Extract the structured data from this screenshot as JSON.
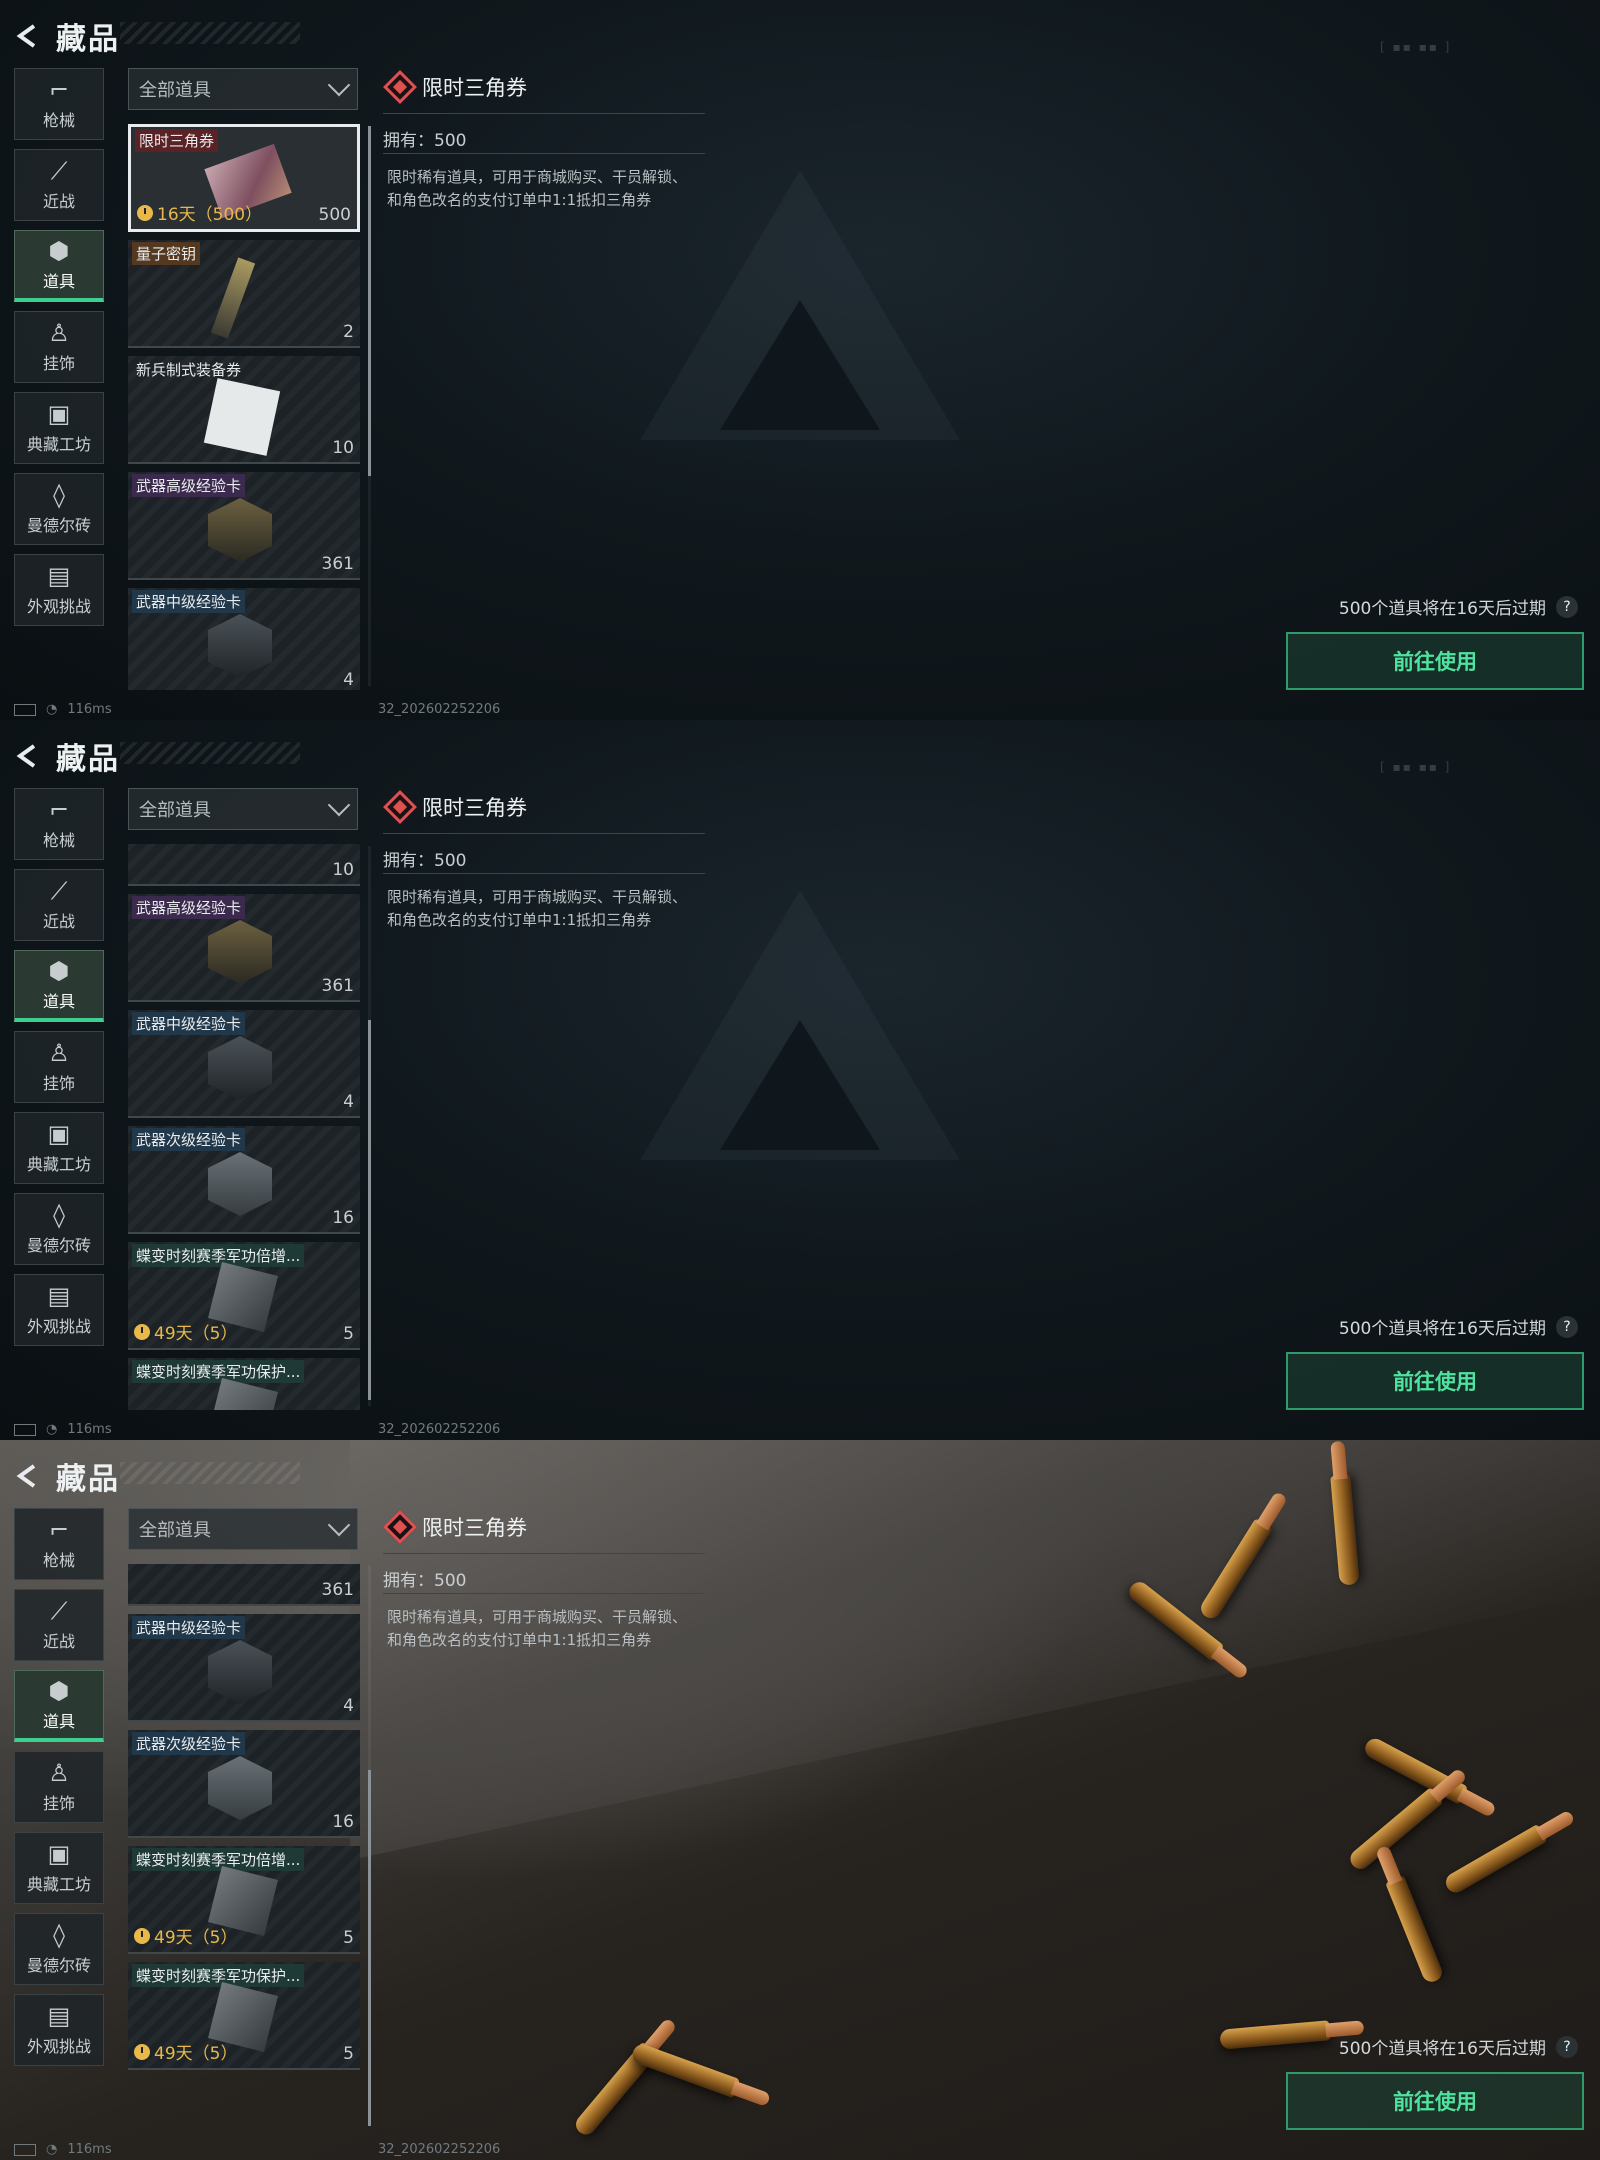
{
  "header": {
    "title": "藏品"
  },
  "sidebar": {
    "items": [
      {
        "label": "枪械",
        "icon": "gun-icon"
      },
      {
        "label": "近战",
        "icon": "knife-icon"
      },
      {
        "label": "道具",
        "icon": "items-icon"
      },
      {
        "label": "挂饰",
        "icon": "charm-icon"
      },
      {
        "label": "典藏工坊",
        "icon": "workshop-icon"
      },
      {
        "label": "曼德尔砖",
        "icon": "brick-icon"
      },
      {
        "label": "外观挑战",
        "icon": "challenge-icon"
      }
    ],
    "active_index": 2
  },
  "filter": {
    "value": "全部道具"
  },
  "items": {
    "ticket": {
      "tag": "限时三角券",
      "timer": "16天（500）",
      "count": "500"
    },
    "quantum_key": {
      "tag": "量子密钥",
      "count": "2"
    },
    "recruit": {
      "tag": "新兵制式装备券",
      "count": "10"
    },
    "weapon_high": {
      "tag": "武器高级经验卡",
      "count": "361"
    },
    "weapon_mid": {
      "tag": "武器中级经验卡",
      "count": "4"
    },
    "weapon_low": {
      "tag": "武器次级经验卡",
      "count": "16"
    },
    "merit_boost": {
      "tag": "蝶变时刻赛季军功倍增...",
      "timer": "49天（5）",
      "count": "5"
    },
    "merit_protect": {
      "tag": "蝶变时刻赛季军功保护...",
      "timer": "49天（5）",
      "count": "5"
    }
  },
  "detail": {
    "name": "限时三角券",
    "owned": "拥有：500",
    "description": "限时稀有道具，可用于商城购买、干员解锁、和角色改名的支付订单中1:1抵扣三角券",
    "expire_note": "500个道具将在16天后过期",
    "help": "?",
    "use_button": "前往使用"
  },
  "status": {
    "ping": "116ms",
    "build": "32_202602252206"
  }
}
